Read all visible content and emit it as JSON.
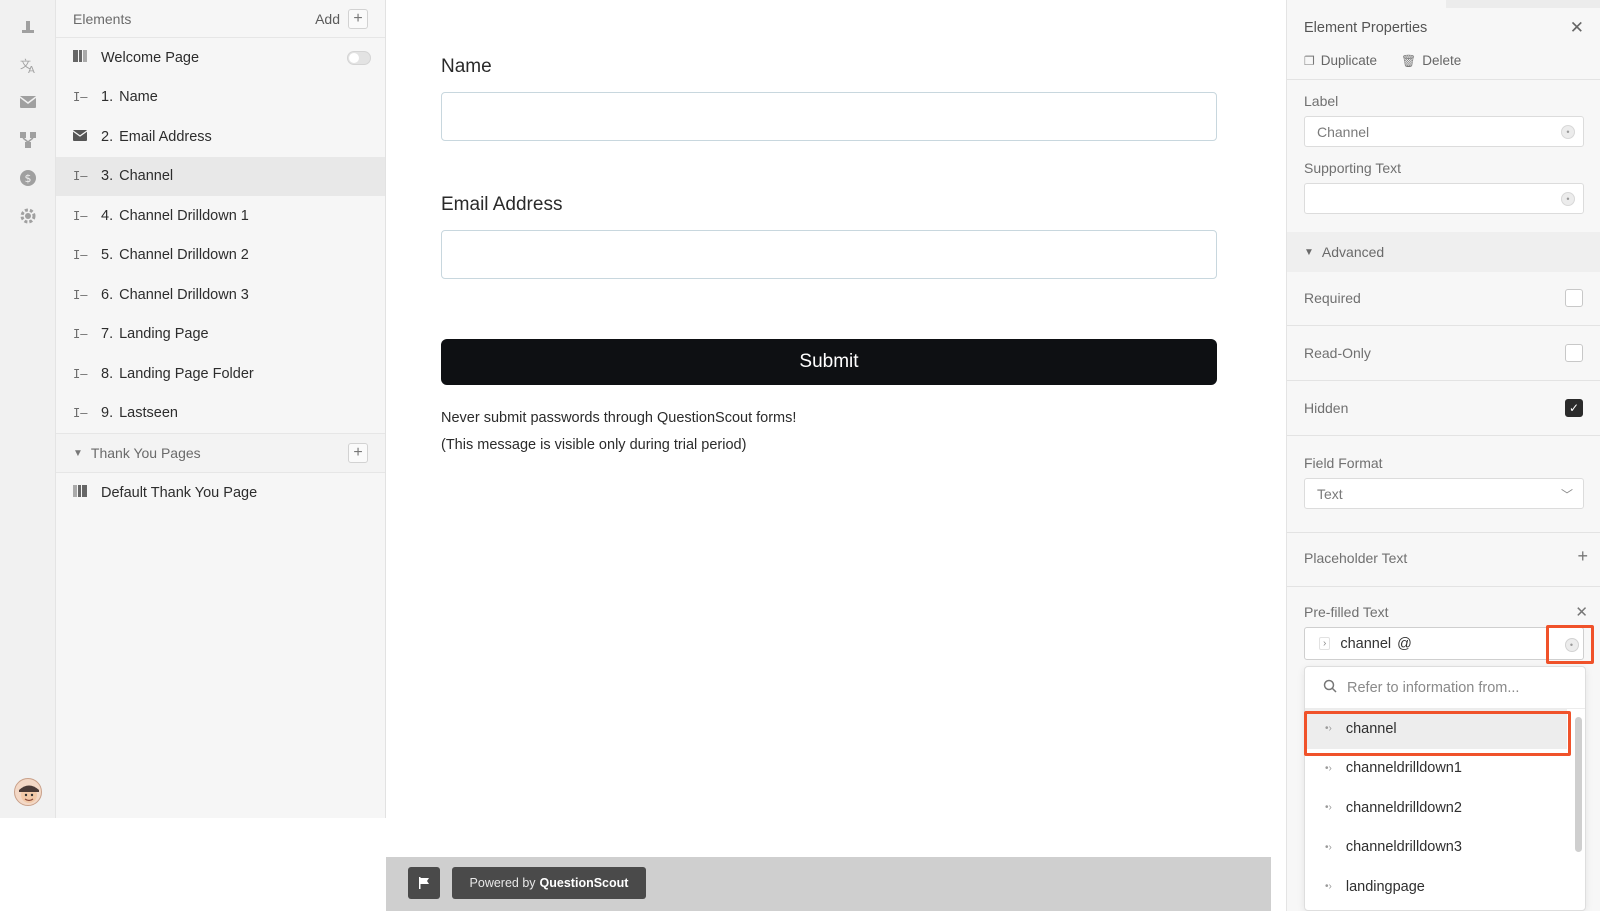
{
  "rail": {
    "icons": [
      "design-icon",
      "translate-icon",
      "email-icon",
      "integrations-icon",
      "billing-icon",
      "settings-icon"
    ]
  },
  "elements_panel": {
    "title": "Elements",
    "add_label": "Add",
    "items": [
      {
        "icon": "page-icon",
        "number": "",
        "label": "Welcome Page"
      },
      {
        "icon": "text-field-icon",
        "number": "1.",
        "label": "Name"
      },
      {
        "icon": "email-icon",
        "number": "2.",
        "label": "Email Address"
      },
      {
        "icon": "text-field-icon",
        "number": "3.",
        "label": "Channel"
      },
      {
        "icon": "text-field-icon",
        "number": "4.",
        "label": "Channel Drilldown 1"
      },
      {
        "icon": "text-field-icon",
        "number": "5.",
        "label": "Channel Drilldown 2"
      },
      {
        "icon": "text-field-icon",
        "number": "6.",
        "label": "Channel Drilldown 3"
      },
      {
        "icon": "text-field-icon",
        "number": "7.",
        "label": "Landing Page"
      },
      {
        "icon": "text-field-icon",
        "number": "8.",
        "label": "Landing Page Folder"
      },
      {
        "icon": "text-field-icon",
        "number": "9.",
        "label": "Lastseen"
      }
    ],
    "thank_you_section": "Thank You Pages",
    "thank_you_items": [
      {
        "label": "Default Thank You Page"
      }
    ]
  },
  "form": {
    "fields": [
      {
        "label": "Name"
      },
      {
        "label": "Email Address"
      }
    ],
    "submit_label": "Submit",
    "notice_line1": "Never submit passwords through QuestionScout forms!",
    "notice_line2": "(This message is visible only during trial period)"
  },
  "footer": {
    "powered_prefix": "Powered by",
    "powered_brand": "QuestionScout"
  },
  "properties": {
    "title": "Element Properties",
    "duplicate": "Duplicate",
    "delete": "Delete",
    "label_heading": "Label",
    "label_value": "Channel",
    "supporting_text_heading": "Supporting Text",
    "supporting_text_value": "",
    "advanced": "Advanced",
    "required": "Required",
    "read_only": "Read-Only",
    "hidden": "Hidden",
    "required_checked": false,
    "read_only_checked": false,
    "hidden_checked": true,
    "field_format_heading": "Field Format",
    "field_format_value": "Text",
    "placeholder_heading": "Placeholder Text",
    "prefilled_heading": "Pre-filled Text",
    "prefilled_tag": "channel",
    "prefilled_suffix": "@",
    "search_placeholder": "Refer to information from...",
    "options": [
      "channel",
      "channeldrilldown1",
      "channeldrilldown2",
      "channeldrilldown3",
      "landingpage"
    ]
  },
  "colors": {
    "highlight": "#f0522a",
    "submit_bg": "#0e1013"
  }
}
